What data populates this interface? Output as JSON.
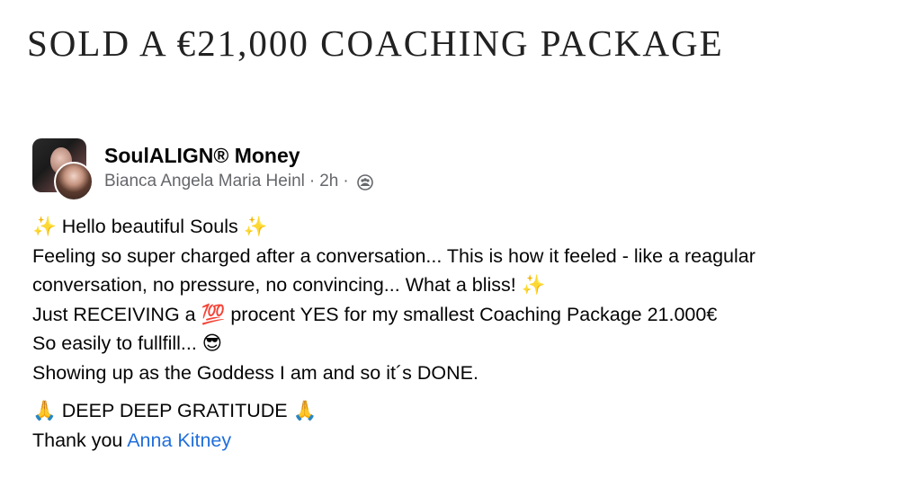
{
  "headline": "SOLD A €21,000 COACHING PACKAGE",
  "post": {
    "group_name": "SoulALIGN® Money",
    "author": "Bianca Angela Maria Heinl",
    "time": "2h",
    "dot": "·",
    "privacy_icon": "group-members-icon",
    "lines": [
      "✨ Hello beautiful Souls ✨",
      "Feeling so super charged after a conversation... This is how it feeled -  like a reagular",
      "conversation, no pressure, no convincing... What a bliss! ✨",
      "Just RECEIVING a 💯 procent YES for my smallest Coaching Package 21.000€",
      "So easily to fullfill... 😎",
      "Showing up as the Goddess I am and so it´s DONE."
    ],
    "gratitude": "🙏 DEEP DEEP GRATITUDE 🙏",
    "thanks_prefix": "Thank you ",
    "mention": "Anna Kitney"
  }
}
